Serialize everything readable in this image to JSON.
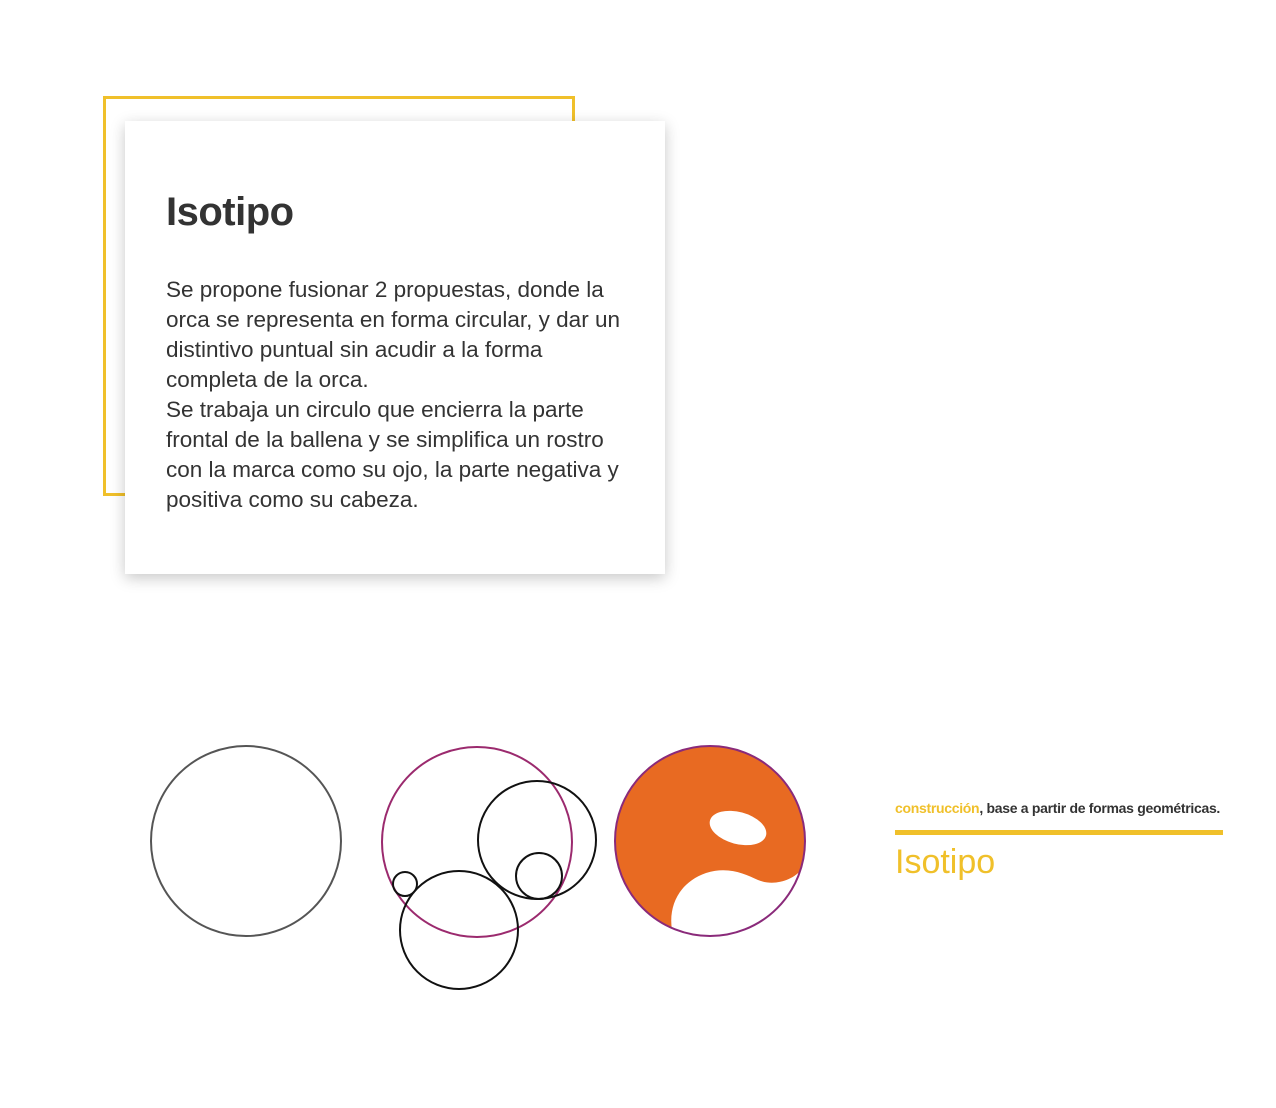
{
  "card": {
    "title": "Isotipo",
    "paragraph_1": "Se propone fusionar 2 propuestas, donde la orca se representa en forma circular, y dar un distintivo  puntual sin acudir a la forma completa de la orca.",
    "paragraph_2": "Se trabaja un circulo que encierra la parte frontal de la ballena y se simplifica un rostro con la marca como su ojo, la parte negativa y positiva como su cabeza."
  },
  "caption": {
    "accent": "construcción",
    "rest": ", base a partir de formas geométricas.",
    "title": "Isotipo"
  },
  "colors": {
    "accent_yellow": "#f0c02a",
    "logo_orange": "#e86a22",
    "circle_outline_magenta": "#9b2a6e",
    "circle_outline_gray": "#555555",
    "text_dark": "#333333"
  },
  "icons": {
    "logo": "orca-isotipo-icon"
  }
}
